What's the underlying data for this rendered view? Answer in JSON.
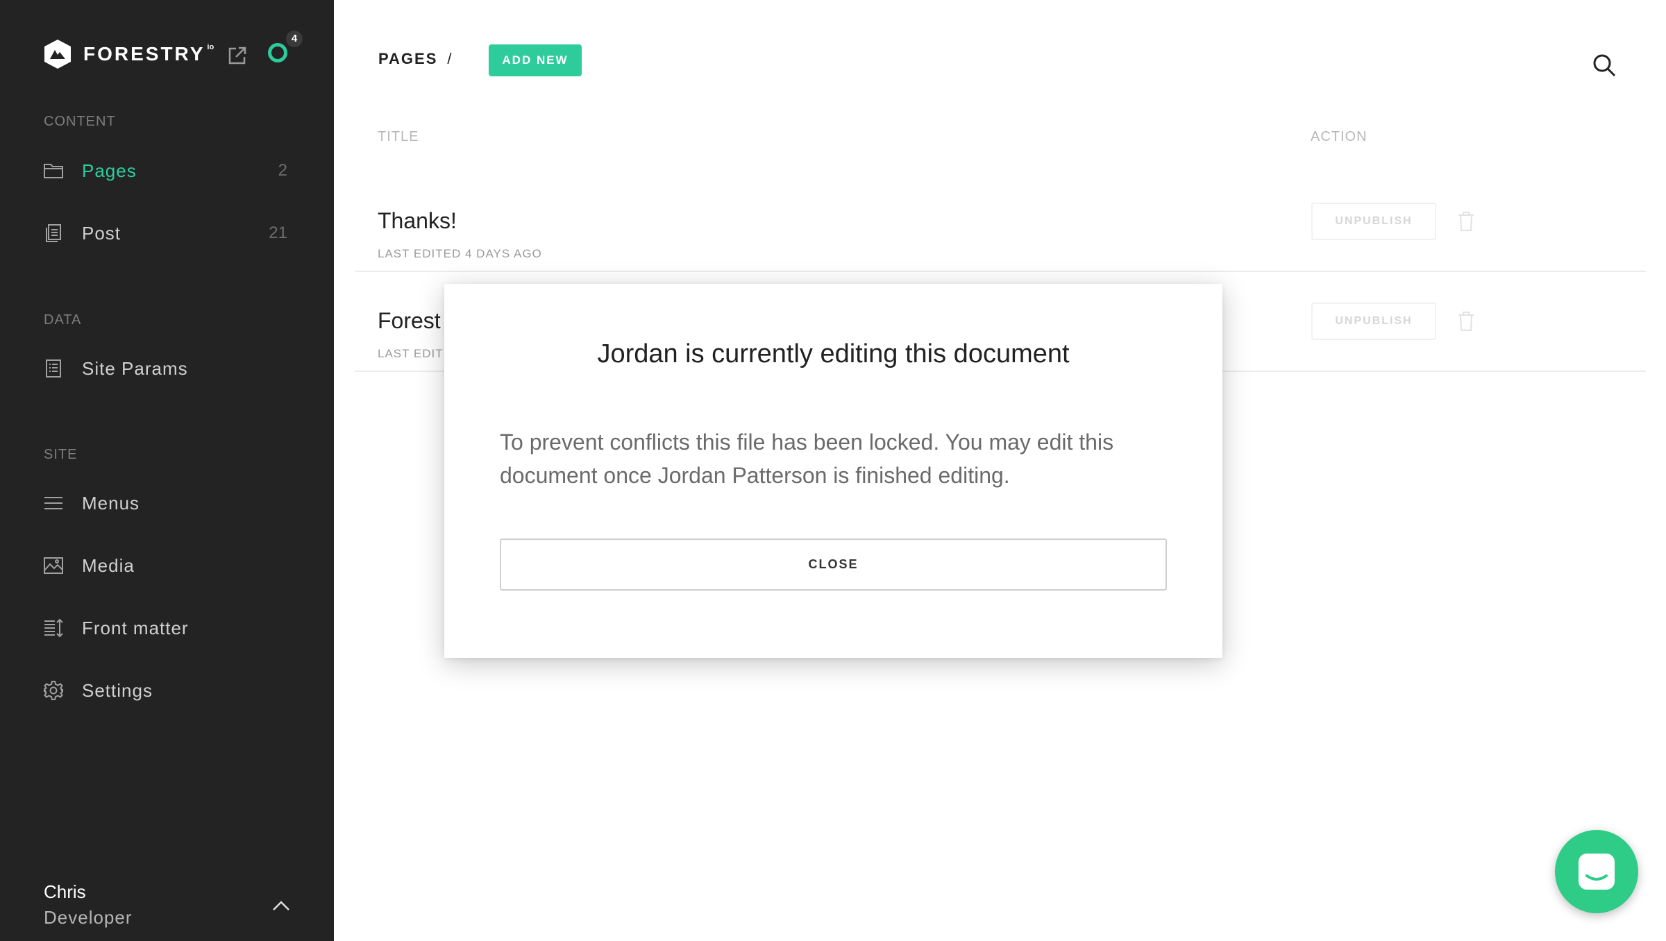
{
  "brand": {
    "name": "FORESTRY",
    "suffix": "io",
    "notification_count": "4"
  },
  "sidebar": {
    "sections": [
      {
        "label": "CONTENT"
      },
      {
        "label": "DATA"
      },
      {
        "label": "SITE"
      }
    ],
    "content_items": [
      {
        "label": "Pages",
        "count": "2",
        "icon": "folder-icon",
        "active": true
      },
      {
        "label": "Post",
        "count": "21",
        "icon": "document-stack-icon",
        "active": false
      }
    ],
    "data_items": [
      {
        "label": "Site Params",
        "icon": "list-document-icon"
      }
    ],
    "site_items": [
      {
        "label": "Menus",
        "icon": "hamburger-menu-icon"
      },
      {
        "label": "Media",
        "icon": "image-icon"
      },
      {
        "label": "Front matter",
        "icon": "sort-list-icon"
      },
      {
        "label": "Settings",
        "icon": "gear-icon"
      }
    ],
    "user": {
      "name": "Chris",
      "role": "Developer"
    }
  },
  "main": {
    "breadcrumb": {
      "label": "PAGES",
      "separator": "/"
    },
    "add_new_label": "ADD NEW",
    "columns": {
      "title": "TITLE",
      "action": "ACTION"
    },
    "rows": [
      {
        "title": "Thanks!",
        "meta": "LAST EDITED 4 DAYS AGO",
        "action": "UNPUBLISH"
      },
      {
        "title": "Forest",
        "meta": "LAST EDITE",
        "action": "UNPUBLISH"
      }
    ]
  },
  "modal": {
    "title": "Jordan is currently editing this document",
    "body": "To prevent conflicts this file has been locked. You may edit this document once Jordan Patterson is finished editing.",
    "close_label": "CLOSE"
  },
  "colors": {
    "accent": "#2ecc9b",
    "sidebar_bg": "#232323",
    "chat": "#2ecc87"
  }
}
